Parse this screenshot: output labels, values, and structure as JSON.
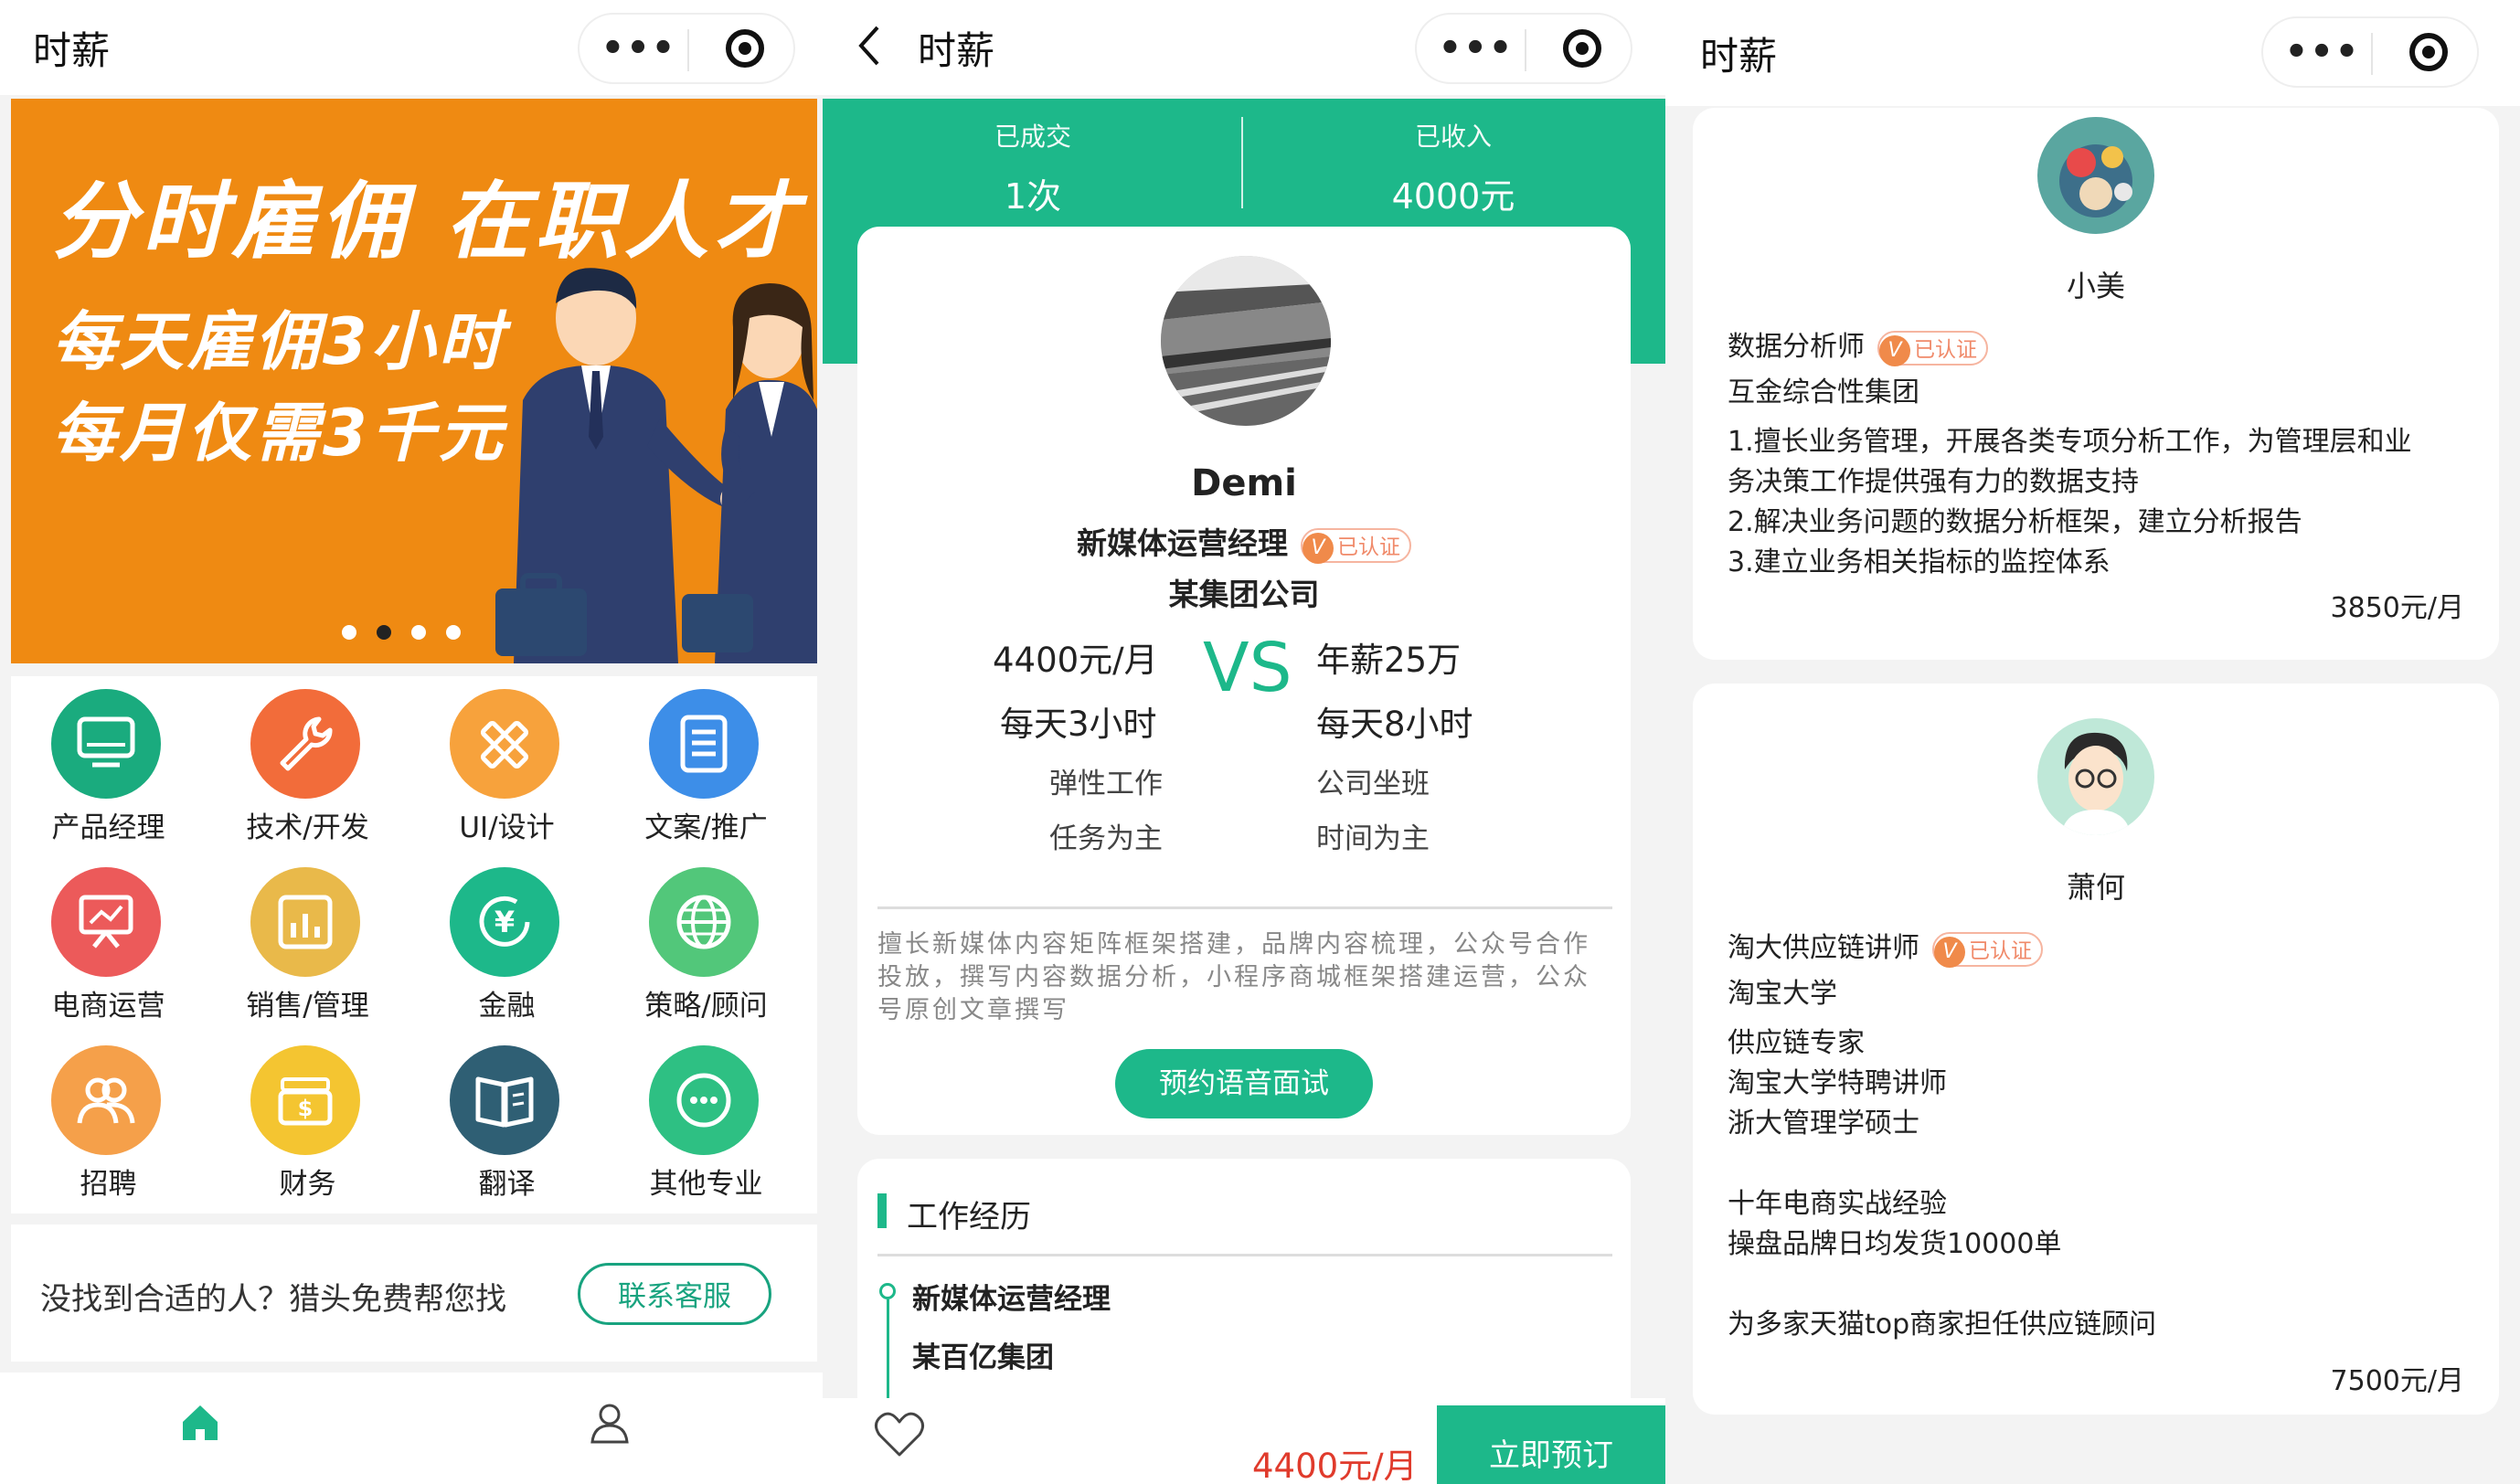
{
  "colors": {
    "accent": "#1db88a",
    "banner_orange": "#ef8a12",
    "price_red": "#e03b2c",
    "verified_orange": "#f08a4a"
  },
  "panel1": {
    "nav_title": "时薪",
    "capsule_menu": "•••",
    "banner": {
      "line1": "分时雇佣 在职人才",
      "line2": "每天雇佣3小时",
      "line3": "每月仅需3千元",
      "dots": 4,
      "active_dot": 2
    },
    "categories": [
      {
        "label": "产品经理",
        "icon": "monitor-icon",
        "color": "#1aab7e"
      },
      {
        "label": "技术/开发",
        "icon": "wrench-icon",
        "color": "#f26c3a"
      },
      {
        "label": "UI/设计",
        "icon": "pencil-ruler-icon",
        "color": "#f7a23c"
      },
      {
        "label": "文案/推广",
        "icon": "document-icon",
        "color": "#3d8ee8"
      },
      {
        "label": "电商运营",
        "icon": "presentation-icon",
        "color": "#ec5a5a"
      },
      {
        "label": "销售/管理",
        "icon": "bar-chart-icon",
        "color": "#e9b94a"
      },
      {
        "label": "金融",
        "icon": "yuan-icon",
        "color": "#1db88a"
      },
      {
        "label": "策略/顾问",
        "icon": "globe-icon",
        "color": "#52c77a"
      },
      {
        "label": "招聘",
        "icon": "people-icon",
        "color": "#f5a04a"
      },
      {
        "label": "财务",
        "icon": "money-icon",
        "color": "#f4c531"
      },
      {
        "label": "翻译",
        "icon": "book-icon",
        "color": "#2f5f74"
      },
      {
        "label": "其他专业",
        "icon": "more-icon",
        "color": "#2ec083"
      }
    ],
    "help_text": "没找到合适的人？猎头免费帮您找",
    "help_button": "联系客服"
  },
  "panel2": {
    "nav_title": "时薪",
    "stats": [
      {
        "key": "已成交",
        "value": "1次"
      },
      {
        "key": "已收入",
        "value": "4000元"
      }
    ],
    "name": "Demi",
    "title": "新媒体运营经理",
    "verified": "已认证",
    "company": "某集团公司",
    "vs": "VS",
    "left": {
      "pay": "4400元/月",
      "hours": "每天3小时",
      "mode": "弹性工作",
      "focus": "任务为主"
    },
    "right": {
      "pay": "年薪25万",
      "hours": "每天8小时",
      "mode": "公司坐班",
      "focus": "时间为主"
    },
    "description": "擅长新媒体内容矩阵框架搭建，品牌内容梳理，公众号合作投放，撰写内容数据分析，小程序商城框架搭建运营，公众号原创文章撰写",
    "interview_button": "预约语音面试",
    "work_section_title": "工作经历",
    "work_role": "新媒体运营经理",
    "work_company": "某百亿集团",
    "bottom_price": "4400元/月",
    "book_button": "立即预订"
  },
  "panel3": {
    "nav_title": "时薪",
    "people": [
      {
        "name": "小美",
        "title": "数据分析师",
        "verified": "已认证",
        "company": "互金综合性集团",
        "lines": [
          "1.擅长业务管理，开展各类专项分析工作，为管理层和业",
          "务决策工作提供强有力的数据支持",
          "2.解决业务问题的数据分析框架，建立分析报告",
          "3.建立业务相关指标的监控体系"
        ],
        "price": "3850元/月"
      },
      {
        "name": "萧何",
        "title": "淘大供应链讲师",
        "verified": "已认证",
        "company": "淘宝大学",
        "lines": [
          "供应链专家",
          "淘宝大学特聘讲师",
          "浙大管理学硕士",
          "",
          "十年电商实战经验",
          "操盘品牌日均发货10000单",
          "",
          "为多家天猫top商家担任供应链顾问"
        ],
        "price": "7500元/月"
      }
    ]
  }
}
